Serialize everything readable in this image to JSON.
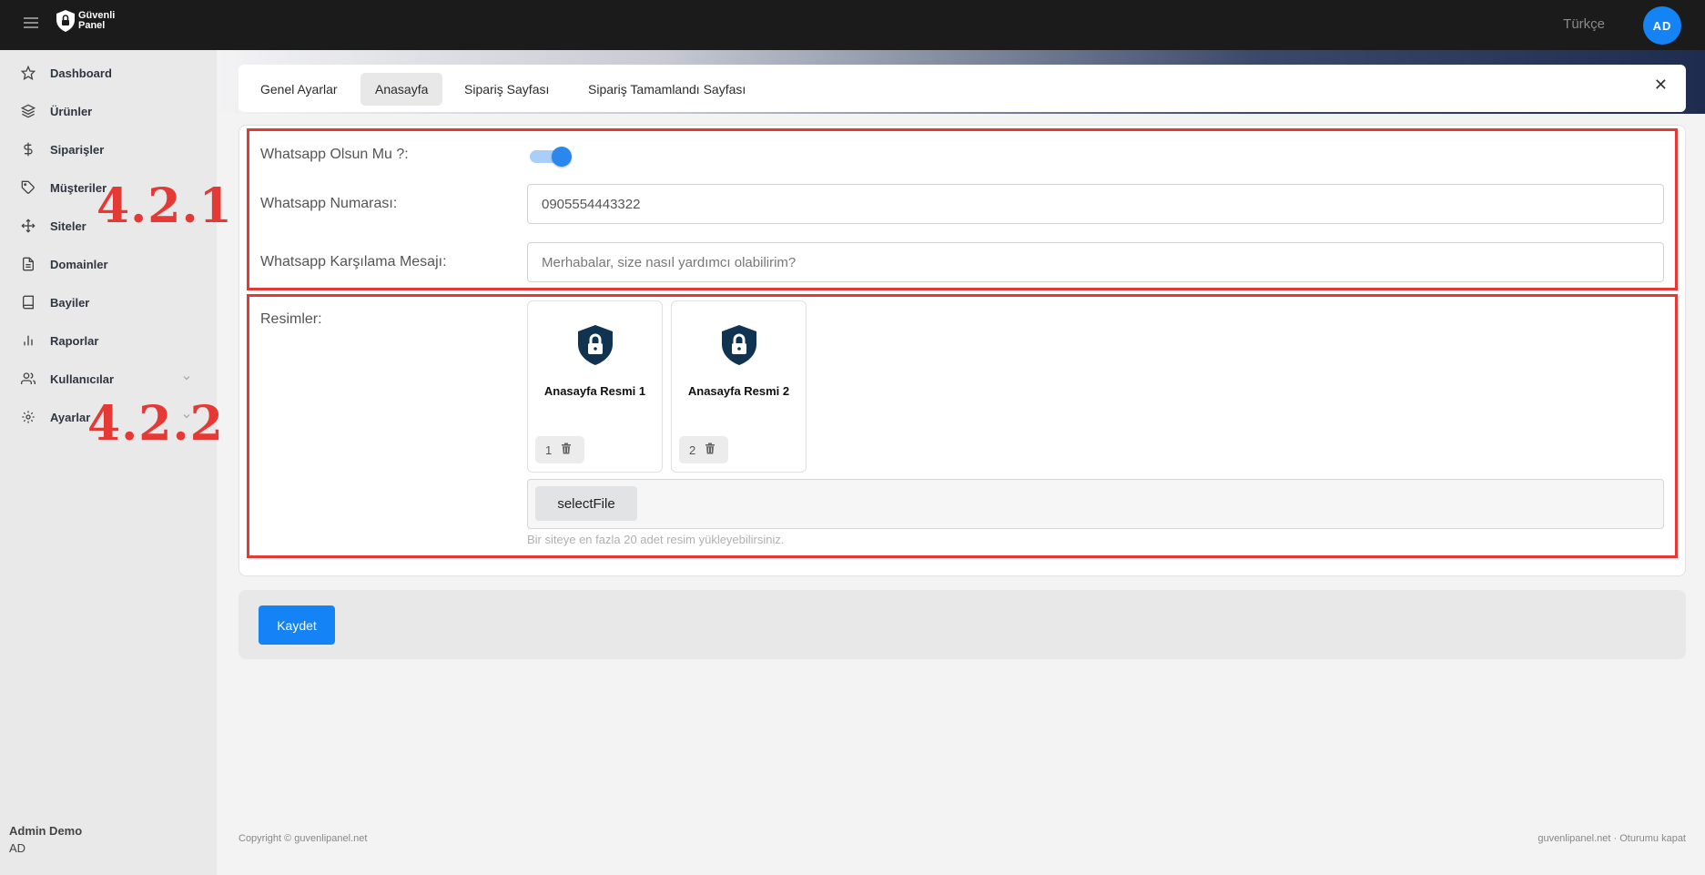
{
  "app": {
    "logo_line1": "Güvenli",
    "logo_line2": "Panel"
  },
  "topbar": {
    "language": "Türkçe",
    "avatar_initials": "AD"
  },
  "sidebar": {
    "items": [
      {
        "label": "Dashboard",
        "icon": "star-icon"
      },
      {
        "label": "Ürünler",
        "icon": "layers-icon"
      },
      {
        "label": "Siparişler",
        "icon": "dollar-icon"
      },
      {
        "label": "Müşteriler",
        "icon": "tag-icon"
      },
      {
        "label": "Siteler",
        "icon": "move-icon"
      },
      {
        "label": "Domainler",
        "icon": "file-icon"
      },
      {
        "label": "Bayiler",
        "icon": "book-icon"
      },
      {
        "label": "Raporlar",
        "icon": "bar-chart-icon"
      },
      {
        "label": "Kullanıcılar",
        "icon": "users-icon"
      },
      {
        "label": "Ayarlar",
        "icon": "gear-icon"
      }
    ],
    "user_name": "Admin Demo",
    "user_initials": "AD"
  },
  "tabs": [
    {
      "label": "Genel Ayarlar",
      "active": false
    },
    {
      "label": "Anasayfa",
      "active": true
    },
    {
      "label": "Sipariş Sayfası",
      "active": false
    },
    {
      "label": "Sipariş Tamamlandı Sayfası",
      "active": false
    }
  ],
  "form": {
    "whatsapp_enabled_label": "Whatsapp Olsun Mu ?:",
    "whatsapp_enabled": true,
    "whatsapp_number_label": "Whatsapp Numarası:",
    "whatsapp_number_value": "0905554443322",
    "whatsapp_message_label": "Whatsapp Karşılama Mesajı:",
    "whatsapp_message_placeholder": "Merhabalar, size nasıl yardımcı olabilirim?",
    "images_label": "Resimler:",
    "images": [
      {
        "title": "Anasayfa Resmi 1",
        "order": "1"
      },
      {
        "title": "Anasayfa Resmi 2",
        "order": "2"
      }
    ],
    "select_file_label": "selectFile",
    "hint": "Bir siteye en fazla 20 adet resim yükleyebilirsiniz."
  },
  "annotations": {
    "section1": "4.2.1",
    "section2": "4.2.2"
  },
  "save_label": "Kaydet",
  "footer": {
    "copyright": "Copyright © guvenlipanel.net",
    "site": "guvenlipanel.net",
    "separator": " · ",
    "logout": "Oturumu kapat"
  },
  "colors": {
    "accent": "#1483f5",
    "highlight": "#e53935",
    "topbar": "#1b1b1c"
  }
}
